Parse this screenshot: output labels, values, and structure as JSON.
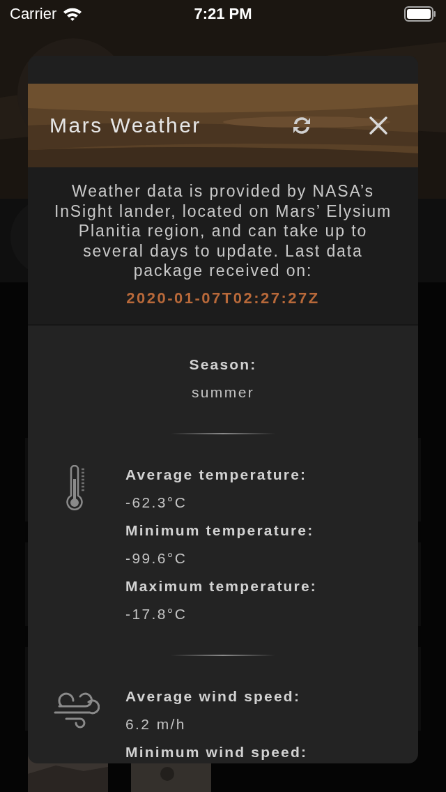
{
  "status_bar": {
    "carrier": "Carrier",
    "time": "7:21 PM"
  },
  "dialog": {
    "title": "Mars Weather",
    "intro": "Weather data is provided by NASA’s InSight lander, located on Mars’ Elysium Planitia region, and can take up to several days to update. Last data package received on:",
    "last_received": "2020-01-07T02:27:27Z",
    "season": {
      "label": "Season:",
      "value": "summer"
    },
    "sections": [
      {
        "kind": "temperature",
        "items": [
          {
            "label": "Average temperature:",
            "value": "-62.3°C"
          },
          {
            "label": "Minimum temperature:",
            "value": "-99.6°C"
          },
          {
            "label": "Maximum temperature:",
            "value": "-17.8°C"
          }
        ]
      },
      {
        "kind": "wind",
        "items": [
          {
            "label": "Average wind speed:",
            "value": "6.2 m/h"
          },
          {
            "label": "Minimum wind speed:"
          }
        ]
      }
    ]
  }
}
